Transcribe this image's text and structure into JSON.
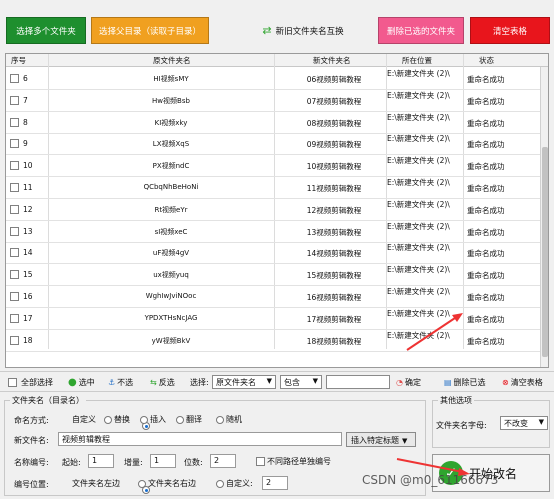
{
  "toolbar": {
    "select_files_label": "选择多个文件夹",
    "select_parent_label": "选择父目录（读取子目录）",
    "swap_label": "新旧文件夹名互换",
    "delete_selected_label": "删除已选的文件夹",
    "clear_table_label": "清空表格",
    "colors": {
      "green": "#1e8f2e",
      "orange": "#f0a020",
      "pink": "#f25a8e",
      "red": "#e8151c"
    }
  },
  "table": {
    "headers": {
      "index": "序号",
      "old_name": "原文件夹名",
      "new_name": "新文件夹名",
      "location": "所在位置",
      "status": "状态"
    },
    "rows": [
      {
        "index": "6",
        "old_name": "HI视频sMY",
        "new_name": "06视频剪辑教程",
        "location": "E:\\新建文件夹 (2)\\",
        "status": "重命名成功"
      },
      {
        "index": "7",
        "old_name": "Hw视频Bsb",
        "new_name": "07视频剪辑教程",
        "location": "E:\\新建文件夹 (2)\\",
        "status": "重命名成功"
      },
      {
        "index": "8",
        "old_name": "KI视频xky",
        "new_name": "08视频剪辑教程",
        "location": "E:\\新建文件夹 (2)\\",
        "status": "重命名成功"
      },
      {
        "index": "9",
        "old_name": "LX视频XqS",
        "new_name": "09视频剪辑教程",
        "location": "E:\\新建文件夹 (2)\\",
        "status": "重命名成功"
      },
      {
        "index": "10",
        "old_name": "PX视频ndC",
        "new_name": "10视频剪辑教程",
        "location": "E:\\新建文件夹 (2)\\",
        "status": "重命名成功"
      },
      {
        "index": "11",
        "old_name": "QCbqNhBeHoNi",
        "new_name": "11视频剪辑教程",
        "location": "E:\\新建文件夹 (2)\\",
        "status": "重命名成功"
      },
      {
        "index": "12",
        "old_name": "Rt视频eYr",
        "new_name": "12视频剪辑教程",
        "location": "E:\\新建文件夹 (2)\\",
        "status": "重命名成功"
      },
      {
        "index": "13",
        "old_name": "sI视频xeC",
        "new_name": "13视频剪辑教程",
        "location": "E:\\新建文件夹 (2)\\",
        "status": "重命名成功"
      },
      {
        "index": "14",
        "old_name": "uF视频4gV",
        "new_name": "14视频剪辑教程",
        "location": "E:\\新建文件夹 (2)\\",
        "status": "重命名成功"
      },
      {
        "index": "15",
        "old_name": "ux视频yuq",
        "new_name": "15视频剪辑教程",
        "location": "E:\\新建文件夹 (2)\\",
        "status": "重命名成功"
      },
      {
        "index": "16",
        "old_name": "WghIwJviNOoc",
        "new_name": "16视频剪辑教程",
        "location": "E:\\新建文件夹 (2)\\",
        "status": "重命名成功"
      },
      {
        "index": "17",
        "old_name": "YPDXTHsNcJAG",
        "new_name": "17视频剪辑教程",
        "location": "E:\\新建文件夹 (2)\\",
        "status": "重命名成功"
      },
      {
        "index": "18",
        "old_name": "yW视频BkV",
        "new_name": "18视频剪辑教程",
        "location": "E:\\新建文件夹 (2)\\",
        "status": "重命名成功"
      }
    ]
  },
  "controls": {
    "select_all": "全部选择",
    "selected": "选中",
    "unselected": "不选",
    "invert": "反选",
    "choose": "选择:",
    "field_value": "原文件夹名",
    "op_value": "包含",
    "filter_value": "",
    "confirm": "确定",
    "delete_selected": "删除已选",
    "clear_table": "清空表格"
  },
  "folder_name_group": {
    "title": "文件夹名（目录名）",
    "mode_label": "命名方式:",
    "modes": [
      "自定义",
      "替换",
      "插入",
      "翻译",
      "随机"
    ],
    "new_name_label": "新文件名:",
    "new_name_value": "视频剪辑教程",
    "insert_tag_label": "插入特定标题",
    "numbering_label": "名称编号:",
    "start_label": "起始:",
    "start_value": "1",
    "step_label": "增量:",
    "step_value": "1",
    "digits_label": "位数:",
    "digits_value": "2",
    "separate_label": "不同路径单独编号",
    "pos_label": "编号位置:",
    "pos_options": [
      "文件夹名左边",
      "文件夹名右边",
      "自定义:"
    ],
    "pos_custom_value": "2"
  },
  "other_group": {
    "title": "其他选项",
    "case_label": "文件夹名字母:",
    "case_value": "不改变"
  },
  "start_button": {
    "label": "开始改名"
  },
  "watermark": "CSDN @m0_61166673"
}
